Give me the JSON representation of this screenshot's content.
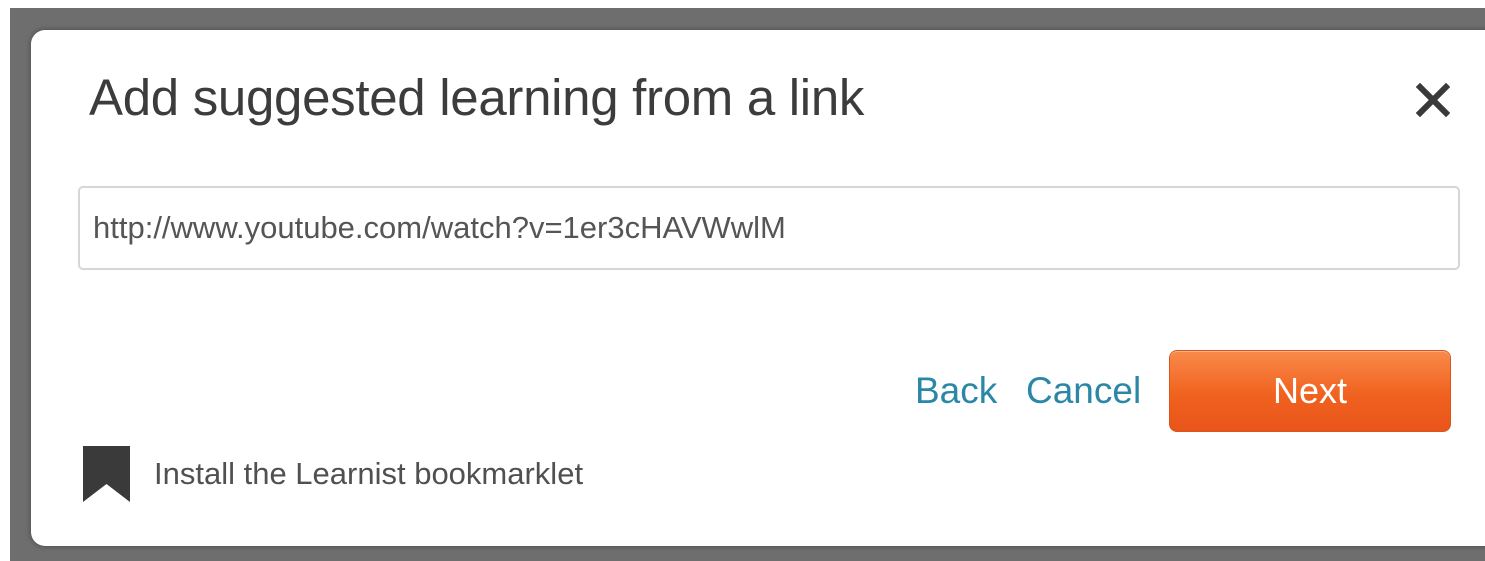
{
  "dialog": {
    "title": "Add suggested learning from a link",
    "close_icon": "close-icon",
    "url_value": "http://www.youtube.com/watch?v=1er3cHAVWwlM"
  },
  "actions": {
    "back_label": "Back",
    "cancel_label": "Cancel",
    "next_label": "Next"
  },
  "footer": {
    "bookmark_icon": "bookmark-icon",
    "bookmarklet_label": "Install the Learnist bookmarklet"
  },
  "colors": {
    "link": "#2a87a6",
    "accent": "#f0621f",
    "overlay": "#6e6e6e",
    "icon": "#3a3a3a"
  }
}
